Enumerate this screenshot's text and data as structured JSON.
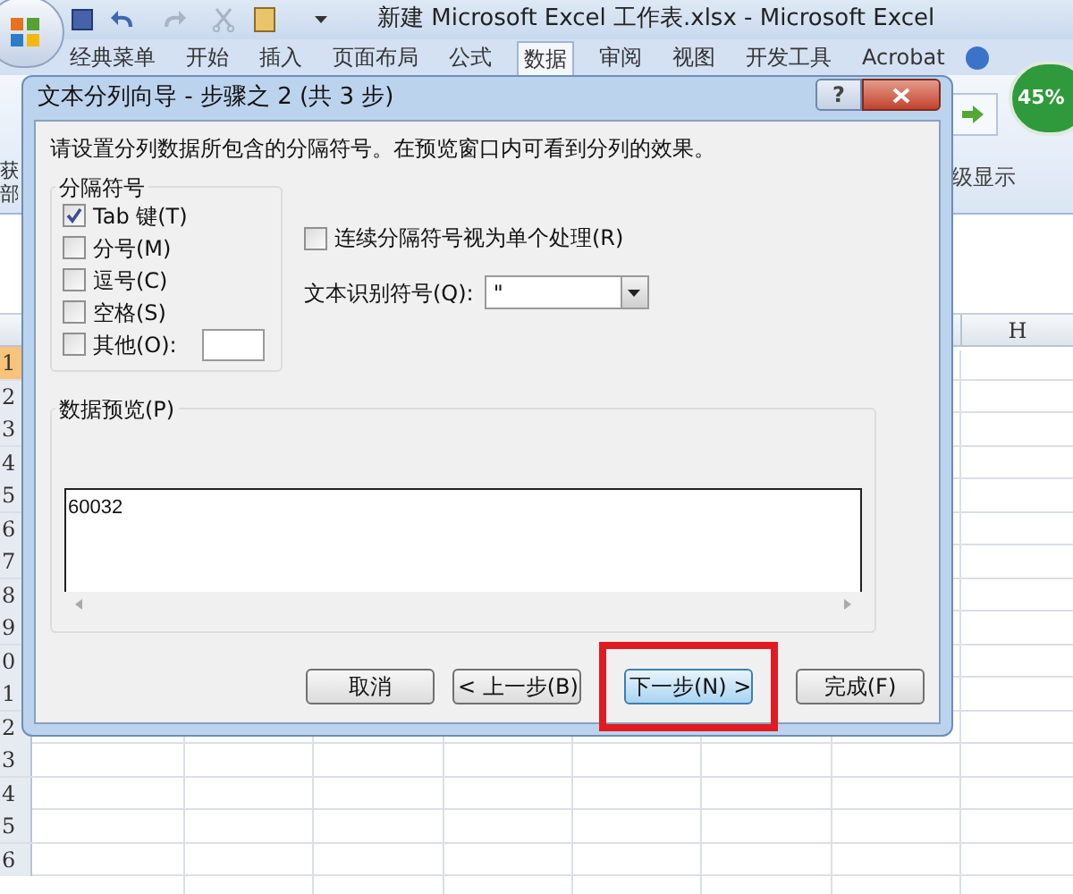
{
  "app": {
    "title": "新建 Microsoft Excel 工作表.xlsx - Microsoft Excel",
    "tabs": [
      {
        "label": "经典菜单",
        "selected": false
      },
      {
        "label": "开始",
        "selected": false
      },
      {
        "label": "插入",
        "selected": false
      },
      {
        "label": "页面布局",
        "selected": false
      },
      {
        "label": "公式",
        "selected": false
      },
      {
        "label": "数据",
        "selected": true
      },
      {
        "label": "审阅",
        "selected": false
      },
      {
        "label": "视图",
        "selected": false
      },
      {
        "label": "开发工具",
        "selected": false
      },
      {
        "label": "Acrobat",
        "selected": false
      }
    ],
    "left_fragments": [
      "获",
      "部"
    ],
    "group_label": "级显示",
    "zoom_badge": "45%"
  },
  "sheet": {
    "column_header": "H",
    "rows": [
      {
        "label": "1",
        "selected": true
      },
      {
        "label": "2",
        "selected": false
      },
      {
        "label": "3",
        "selected": false
      },
      {
        "label": "4",
        "selected": false
      },
      {
        "label": "5",
        "selected": false
      },
      {
        "label": "6",
        "selected": false
      },
      {
        "label": "7",
        "selected": false
      },
      {
        "label": "8",
        "selected": false
      },
      {
        "label": "9",
        "selected": false
      },
      {
        "label": "0",
        "selected": false
      },
      {
        "label": "1",
        "selected": false
      },
      {
        "label": "2",
        "selected": false
      },
      {
        "label": "3",
        "selected": false
      },
      {
        "label": "4",
        "selected": false
      },
      {
        "label": "5",
        "selected": false
      },
      {
        "label": "6",
        "selected": false
      }
    ]
  },
  "dialog": {
    "title": "文本分列向导 - 步骤之 2 (共 3 步)",
    "help": "?",
    "instruction": "请设置分列数据所包含的分隔符号。在预览窗口内可看到分列的效果。",
    "delimiters": {
      "legend": "分隔符号",
      "options": [
        {
          "kind": "plain",
          "label": "Tab 键(T)",
          "checked": true
        },
        {
          "kind": "plain",
          "label": "分号(M)",
          "checked": false
        },
        {
          "kind": "plain",
          "label": "逗号(C)",
          "checked": false
        },
        {
          "kind": "plain",
          "label": "空格(S)",
          "checked": false
        },
        {
          "kind": "other",
          "label": "其他(O):",
          "checked": false
        }
      ]
    },
    "consecutive": {
      "label": "连续分隔符号视为单个处理(R)",
      "checked": false
    },
    "qualifier": {
      "label": "文本识别符号(Q):",
      "value": "\""
    },
    "preview": {
      "legend": "数据预览(P)",
      "lines": [
        "60032"
      ]
    },
    "buttons": [
      {
        "label": "取消",
        "focused": false,
        "highlighted": false
      },
      {
        "label": "< 上一步(B)",
        "focused": false,
        "highlighted": false
      },
      {
        "label": "下一步(N) >",
        "focused": true,
        "highlighted": true
      },
      {
        "label": "完成(F)",
        "focused": false,
        "highlighted": false
      }
    ]
  }
}
